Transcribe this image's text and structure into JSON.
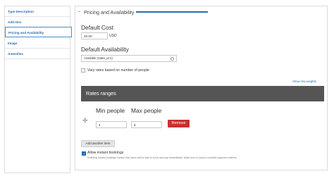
{
  "sidebar": {
    "items": [
      {
        "label": "Type Description"
      },
      {
        "label": "Add-Ons"
      },
      {
        "label": "Pricing and Availability"
      },
      {
        "label": "Image"
      },
      {
        "label": "Amenities"
      }
    ],
    "active_index": 2
  },
  "section": {
    "toggle": "–",
    "title": "Pricing and Availability"
  },
  "default_cost": {
    "label": "Default Cost",
    "value": "20.00",
    "unit": "USD"
  },
  "default_availability": {
    "label": "Default Availability",
    "value": "Available (state_id:1)"
  },
  "vary_rates": {
    "label": "Vary rates based on number of people",
    "checked": false
  },
  "show_weights_link": "Show row weights",
  "rates_ranges": {
    "title": "Rates ranges",
    "min_label": "Min people",
    "max_label": "Max people",
    "rows": [
      {
        "min": "4",
        "max": "6"
      }
    ],
    "remove_label": "Remove",
    "add_label": "Add another item"
  },
  "instant_bookings": {
    "label": "Allow instant bookings",
    "checked": true,
    "help": "Enabling instant bookings means that users will be able to book and pay immediately. Make sure to setup a suitable payment method."
  },
  "colors": {
    "link_blue": "#2b6cb0",
    "header_dark": "#555555",
    "remove_red": "#c9302c"
  }
}
